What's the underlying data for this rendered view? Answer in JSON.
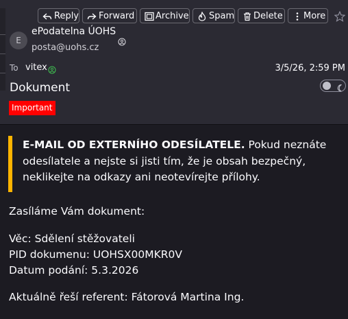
{
  "toolbar": {
    "reply_label": "Reply",
    "forward_label": "Forward",
    "archive_label": "Archive",
    "spam_label": "Spam",
    "delete_label": "Delete",
    "more_label": "More"
  },
  "sender": {
    "avatar_initial": "E",
    "name": "ePodatelna ÚOHS",
    "email": "posta@uohs.cz"
  },
  "recipient": {
    "label": "To",
    "name": "vitex"
  },
  "date": "3/5/26, 2:59 PM",
  "subject": "Dokument",
  "tag": "Important",
  "message": {
    "warning_bold": "E-MAIL OD EXTERNÍHO ODESÍLATELE.",
    "warning_text": " Pokud neznáte odesílatele a nejste si jisti tím, že je obsah bezpečný, neklikejte na odkazy ani neotevírejte přílohy.",
    "greeting": "Zasíláme Vám dokument:",
    "subject_line": "Věc: Sdělení stěžovateli",
    "pid_line": "PID dokumenu: UOHSX00MKR0V",
    "date_line": "Datum podání: 5.3.2026",
    "referent_line": "Aktuálně řeší referent: Fátorová Martina Ing."
  },
  "colors": {
    "header_bg": "#2b2a33",
    "body_bg": "#1c1b22",
    "warning_accent": "#ffb400",
    "tag_bg": "#ff0000",
    "status_green": "#3fb950"
  }
}
